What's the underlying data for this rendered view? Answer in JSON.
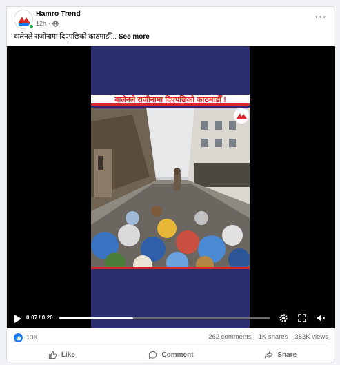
{
  "post": {
    "page_name": "Hamro Trend",
    "time": "12h",
    "dot": "·",
    "caption": "बालेनले राजीनामा दिएपछिको काठमाडौँ...",
    "see_more": "See more",
    "avatar_text": "HT"
  },
  "video": {
    "title_text": "बालेनले राजीनामा दिएपछिको काठमाडौँ !",
    "logo_text": "HT",
    "current_time": "0:07",
    "duration": "0:20",
    "time_sep": " / ",
    "progress": 0.35
  },
  "stats": {
    "reactions": "13K",
    "comments": "262 comments",
    "shares": "1K shares",
    "views": "383K views"
  },
  "actions": {
    "like": "Like",
    "comment": "Comment",
    "share": "Share"
  },
  "colors": {
    "accent": "#1877f2",
    "title_red": "#d62828",
    "video_bg": "#2a2d6e",
    "online": "#31a24c"
  }
}
